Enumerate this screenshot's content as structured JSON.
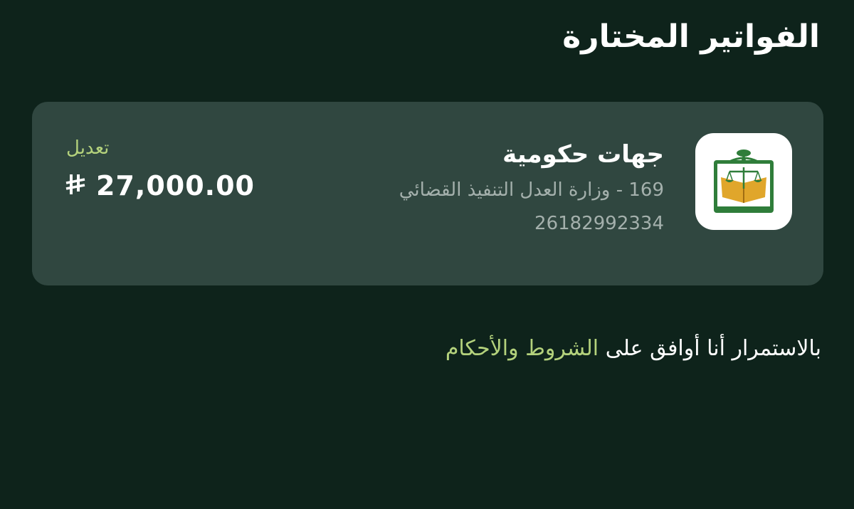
{
  "page": {
    "title": "الفواتير المختارة"
  },
  "bill": {
    "logo_icon": "ministry-of-justice-emblem",
    "name": "جهات حكومية",
    "service": "169 - وزارة العدل التنفيذ القضائي",
    "number": "26182992334",
    "edit_label": "تعديل",
    "amount": "27,000.00",
    "currency_icon": "saudi-riyal-icon"
  },
  "terms": {
    "prefix": "بالاستمرار أنا أوافق على ",
    "link_label": "الشروط والأحكام"
  },
  "colors": {
    "background": "#0e231b",
    "card": "#304740",
    "accent": "#b4d27c",
    "muted_text": "#a4b0ac"
  }
}
